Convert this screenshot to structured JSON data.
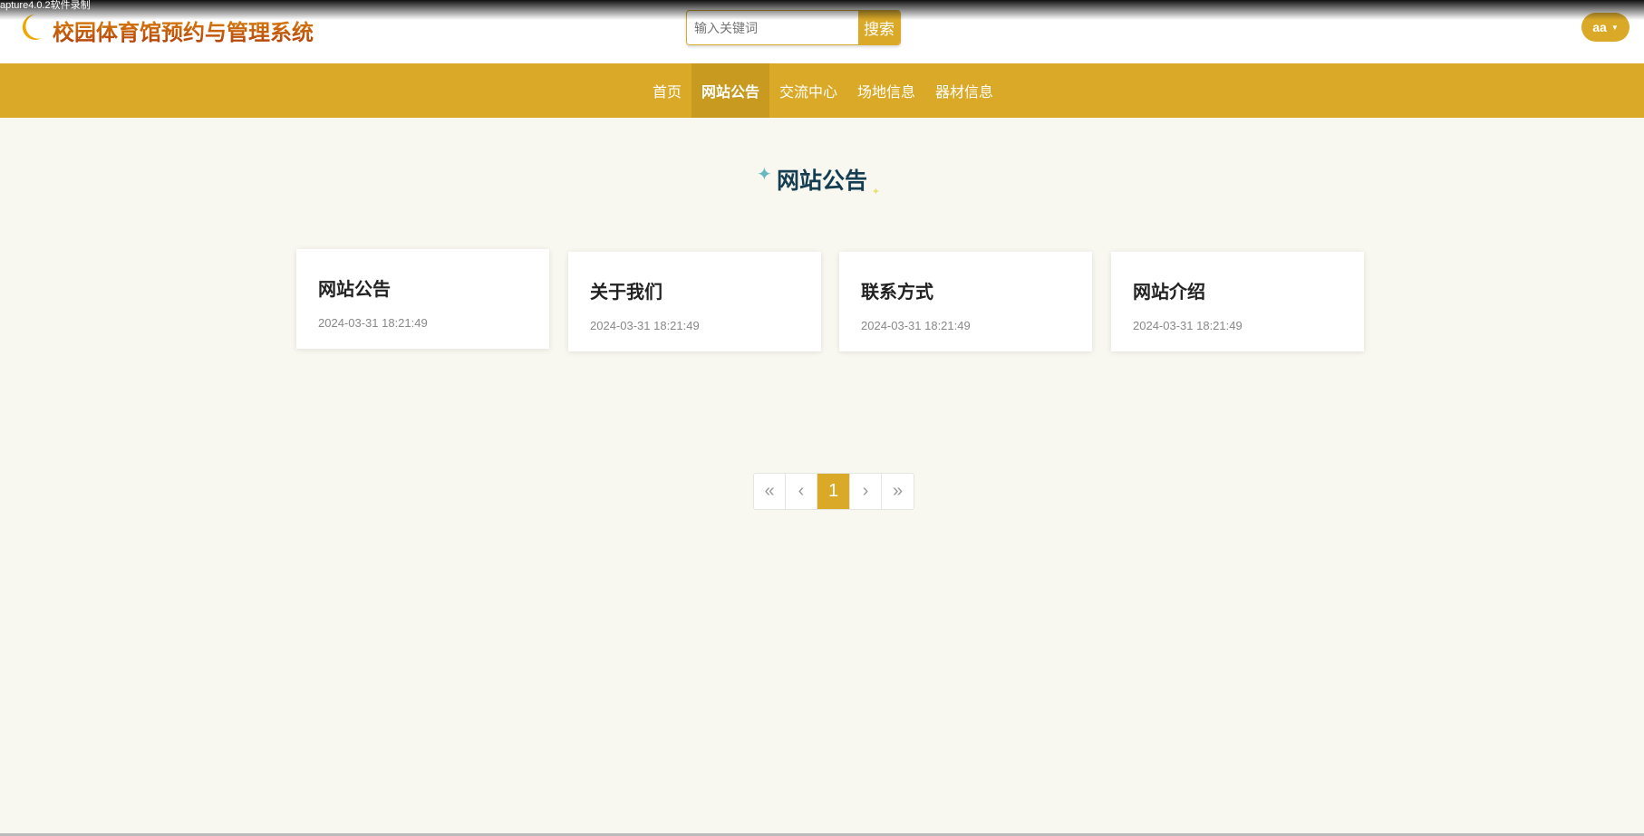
{
  "recorder_text": "apture4.0.2软件录制",
  "header": {
    "title": "校园体育馆预约与管理系统",
    "search_placeholder": "输入关键词",
    "search_button": "搜索",
    "user": "aa"
  },
  "nav": [
    {
      "label": "首页"
    },
    {
      "label": "网站公告"
    },
    {
      "label": "交流中心"
    },
    {
      "label": "场地信息"
    },
    {
      "label": "器材信息"
    }
  ],
  "section_title": "网站公告",
  "cards": [
    {
      "title": "网站公告",
      "date": "2024-03-31 18:21:49"
    },
    {
      "title": "关于我们",
      "date": "2024-03-31 18:21:49"
    },
    {
      "title": "联系方式",
      "date": "2024-03-31 18:21:49"
    },
    {
      "title": "网站介绍",
      "date": "2024-03-31 18:21:49"
    }
  ],
  "pagination": {
    "first": "«",
    "prev": "‹",
    "current": "1",
    "next": "›",
    "last": "»"
  }
}
